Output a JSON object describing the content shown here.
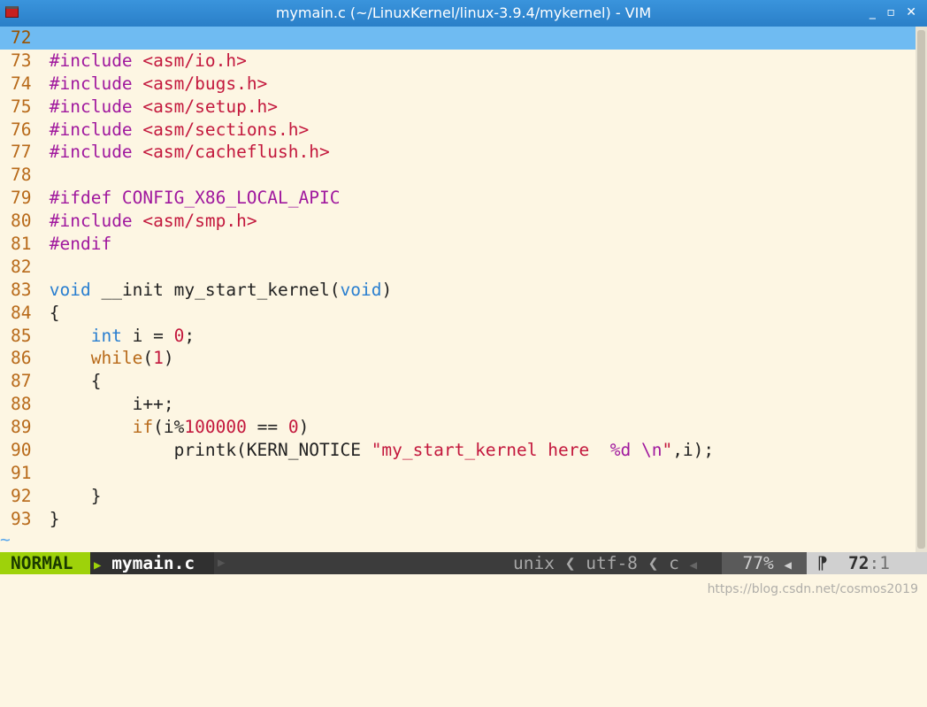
{
  "window": {
    "title": "mymain.c (~/LinuxKernel/linux-3.9.4/mykernel) - VIM",
    "buttons": "_ ▫ ✕"
  },
  "editor": {
    "lines": [
      {
        "n": "72",
        "code": ""
      },
      {
        "n": "73",
        "code": "#include <asm/io.h>"
      },
      {
        "n": "74",
        "code": "#include <asm/bugs.h>"
      },
      {
        "n": "75",
        "code": "#include <asm/setup.h>"
      },
      {
        "n": "76",
        "code": "#include <asm/sections.h>"
      },
      {
        "n": "77",
        "code": "#include <asm/cacheflush.h>"
      },
      {
        "n": "78",
        "code": ""
      },
      {
        "n": "79",
        "code": "#ifdef CONFIG_X86_LOCAL_APIC"
      },
      {
        "n": "80",
        "code": "#include <asm/smp.h>"
      },
      {
        "n": "81",
        "code": "#endif"
      },
      {
        "n": "82",
        "code": ""
      },
      {
        "n": "83",
        "code": "void __init my_start_kernel(void)"
      },
      {
        "n": "84",
        "code": "{"
      },
      {
        "n": "85",
        "code": "    int i = 0;"
      },
      {
        "n": "86",
        "code": "    while(1)"
      },
      {
        "n": "87",
        "code": "    {"
      },
      {
        "n": "88",
        "code": "        i++;"
      },
      {
        "n": "89",
        "code": "        if(i%100000 == 0)"
      },
      {
        "n": "90",
        "code": "            printk(KERN_NOTICE \"my_start_kernel here  %d \\n\",i);"
      },
      {
        "n": "91",
        "code": ""
      },
      {
        "n": "92",
        "code": "    }"
      },
      {
        "n": "93",
        "code": "}"
      }
    ],
    "tilde": "~"
  },
  "statusline": {
    "mode": "NORMAL",
    "filename": "mymain.c",
    "fileformat": "unix",
    "encoding": "utf-8",
    "filetype": "c",
    "percent": "77%",
    "line": "72",
    "column": "1"
  },
  "watermark": "https://blog.csdn.net/cosmos2019",
  "colors": {
    "background": "#fdf6e3",
    "cursorline": "#6fbbf2",
    "preprocessor": "#a0189e",
    "string": "#c3183d",
    "type": "#2a7fd0",
    "keyword": "#b86a1a",
    "mode_bg": "#9ed20a"
  }
}
